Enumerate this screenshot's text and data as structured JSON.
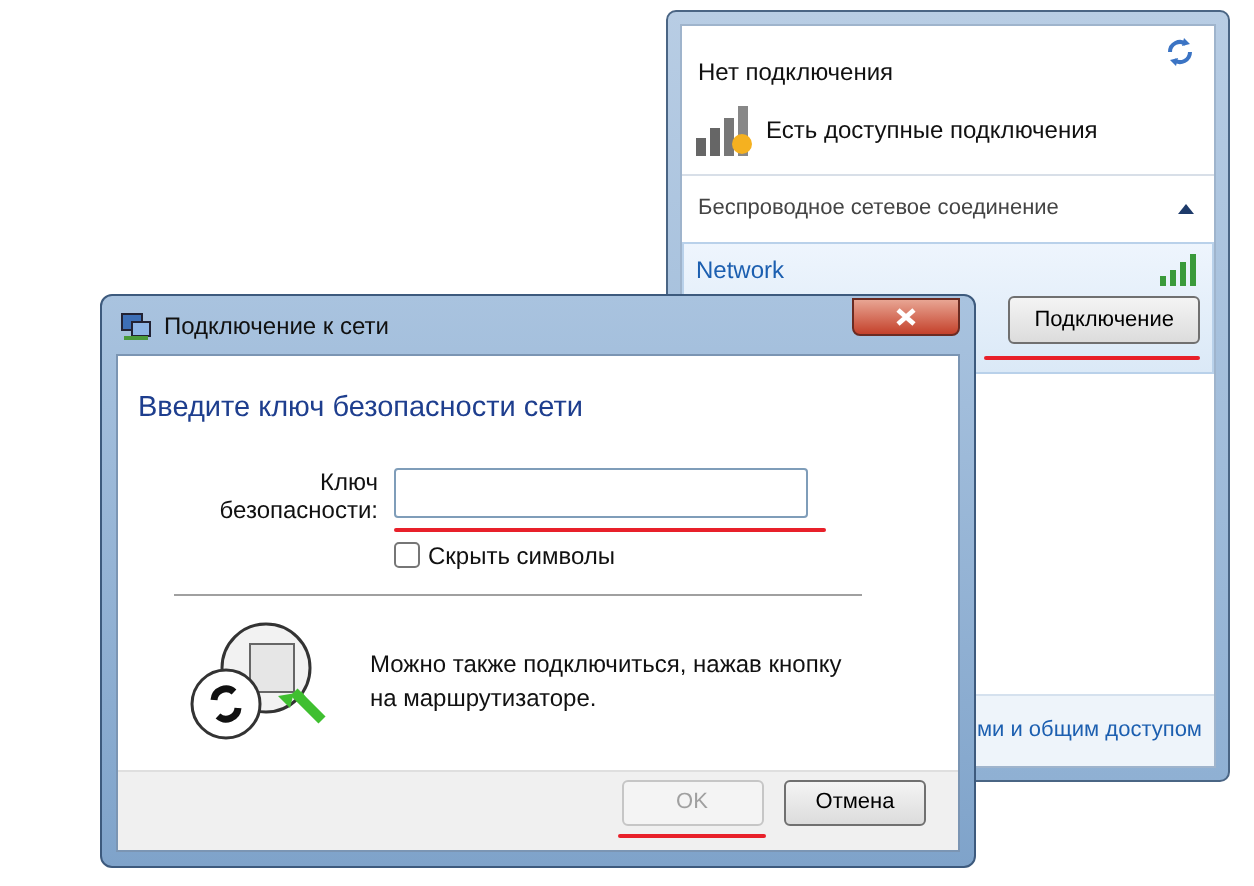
{
  "flyout": {
    "status_title": "Нет подключения",
    "available_text": "Есть доступные подключения",
    "section_title": "Беспроводное сетевое соединение",
    "section_expanded": true,
    "networks": [
      {
        "name": "Network",
        "selected": true,
        "button": "Подключение"
      }
    ],
    "footer_link": "ми и общим доступом"
  },
  "dialog": {
    "title": "Подключение к сети",
    "heading": "Введите ключ безопасности сети",
    "key_label": "Ключ безопасности:",
    "hide_chars": {
      "label": "Скрыть символы",
      "checked": false
    },
    "hint": "Можно также подключиться, нажав кнопку на маршрутизаторе.",
    "buttons": [
      {
        "label": "OK",
        "disabled": true
      },
      {
        "label": "Отмена",
        "disabled": false
      }
    ]
  }
}
